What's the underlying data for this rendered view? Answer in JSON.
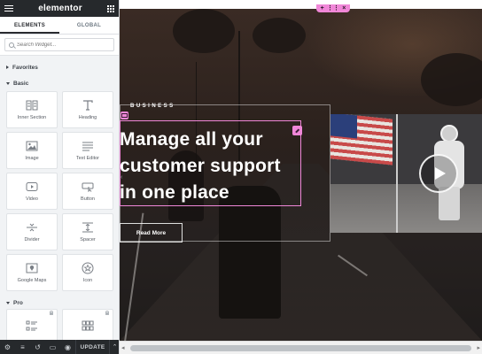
{
  "app": {
    "logo": "elementor"
  },
  "panel": {
    "tabs": [
      {
        "label": "ELEMENTS",
        "active": true
      },
      {
        "label": "GLOBAL",
        "active": false
      }
    ],
    "search": {
      "placeholder": "Search Widget..."
    },
    "sections": {
      "favorites": "Favorites",
      "basic": "Basic",
      "pro": "Pro"
    },
    "basic_widgets": [
      {
        "label": "Inner Section",
        "icon": "inner-section-icon"
      },
      {
        "label": "Heading",
        "icon": "heading-icon"
      },
      {
        "label": "Image",
        "icon": "image-icon"
      },
      {
        "label": "Text Editor",
        "icon": "text-editor-icon"
      },
      {
        "label": "Video",
        "icon": "video-icon"
      },
      {
        "label": "Button",
        "icon": "button-icon"
      },
      {
        "label": "Divider",
        "icon": "divider-icon"
      },
      {
        "label": "Spacer",
        "icon": "spacer-icon"
      },
      {
        "label": "Google Maps",
        "icon": "google-maps-icon"
      },
      {
        "label": "Icon",
        "icon": "star-icon"
      }
    ],
    "bottom": {
      "update_label": "UPDATE"
    }
  },
  "canvas": {
    "eyebrow": "BUSINESS",
    "heading": "Manage all your customer support in one place",
    "button_label": "Read More",
    "handle_colors": {
      "pink": "#f087d8"
    }
  }
}
